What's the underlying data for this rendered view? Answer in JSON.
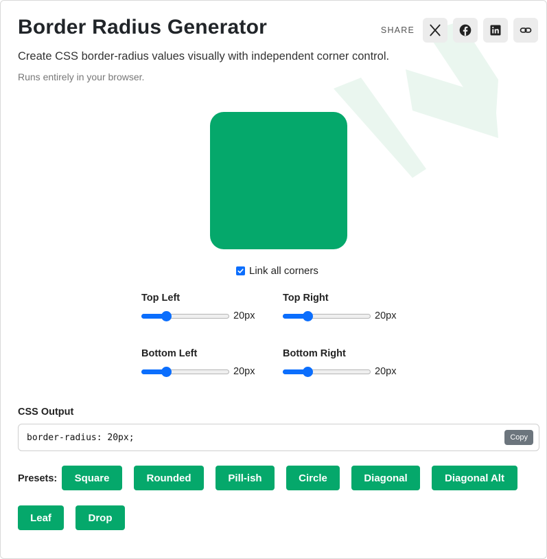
{
  "header": {
    "title": "Border Radius Generator",
    "subtitle": "Create CSS border-radius values visually with independent corner control.",
    "note": "Runs entirely in your browser."
  },
  "share": {
    "label": "SHARE",
    "buttons": [
      {
        "name": "x-share-button",
        "icon": "x-logo-icon"
      },
      {
        "name": "facebook-share-button",
        "icon": "facebook-icon"
      },
      {
        "name": "linkedin-share-button",
        "icon": "linkedin-icon"
      },
      {
        "name": "copy-link-button",
        "icon": "link-icon"
      }
    ]
  },
  "preview": {
    "color": "#05a86b",
    "radius": "20px"
  },
  "link_corners": {
    "label": "Link all corners",
    "checked": true
  },
  "corners": {
    "top_left": {
      "label": "Top Left",
      "value": "20px",
      "level": 0.25
    },
    "top_right": {
      "label": "Top Right",
      "value": "20px",
      "level": 0.25
    },
    "bottom_left": {
      "label": "Bottom Left",
      "value": "20px",
      "level": 0.25
    },
    "bottom_right": {
      "label": "Bottom Right",
      "value": "20px",
      "level": 0.25
    }
  },
  "output": {
    "label": "CSS Output",
    "code": "border-radius: 20px;",
    "copy_label": "Copy"
  },
  "presets": {
    "label": "Presets:",
    "items": [
      "Square",
      "Rounded",
      "Pill-ish",
      "Circle",
      "Diagonal",
      "Diagonal Alt",
      "Leaf",
      "Drop"
    ]
  },
  "colors": {
    "accent": "#05a86b",
    "slider": "#0b6efd",
    "copy_button": "#6c757d"
  }
}
